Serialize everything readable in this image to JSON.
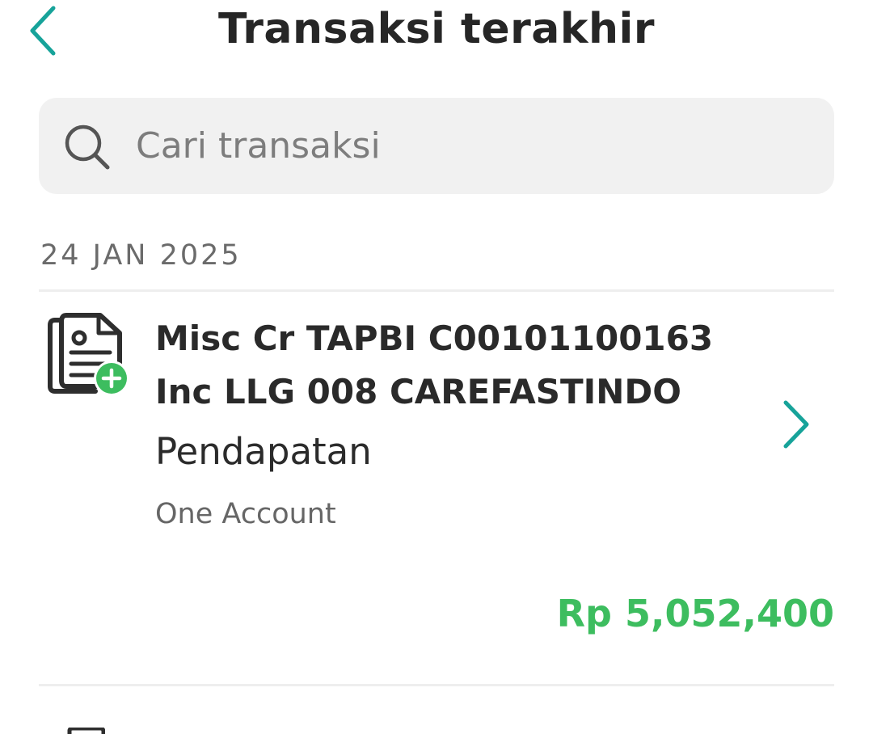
{
  "header": {
    "title": "Transaksi terakhir",
    "back_icon": "chevron-left-icon"
  },
  "search": {
    "placeholder": "Cari transaksi",
    "icon": "search-icon"
  },
  "transactions": [
    {
      "date": "24 JAN 2025",
      "description_lines": [
        "Misc Cr TAPBI C00101100163",
        "Inc LLG 008 CAREFASTINDO"
      ],
      "category": "Pendapatan",
      "account": "One Account",
      "amount": "Rp 5,052,400",
      "icon": "document-plus-icon",
      "chevron_icon": "chevron-right-icon"
    }
  ],
  "colors": {
    "accent": "#17a39a",
    "amount_positive": "#3dbd5f",
    "title_text": "#262626",
    "search_bg": "#f1f1f1"
  }
}
